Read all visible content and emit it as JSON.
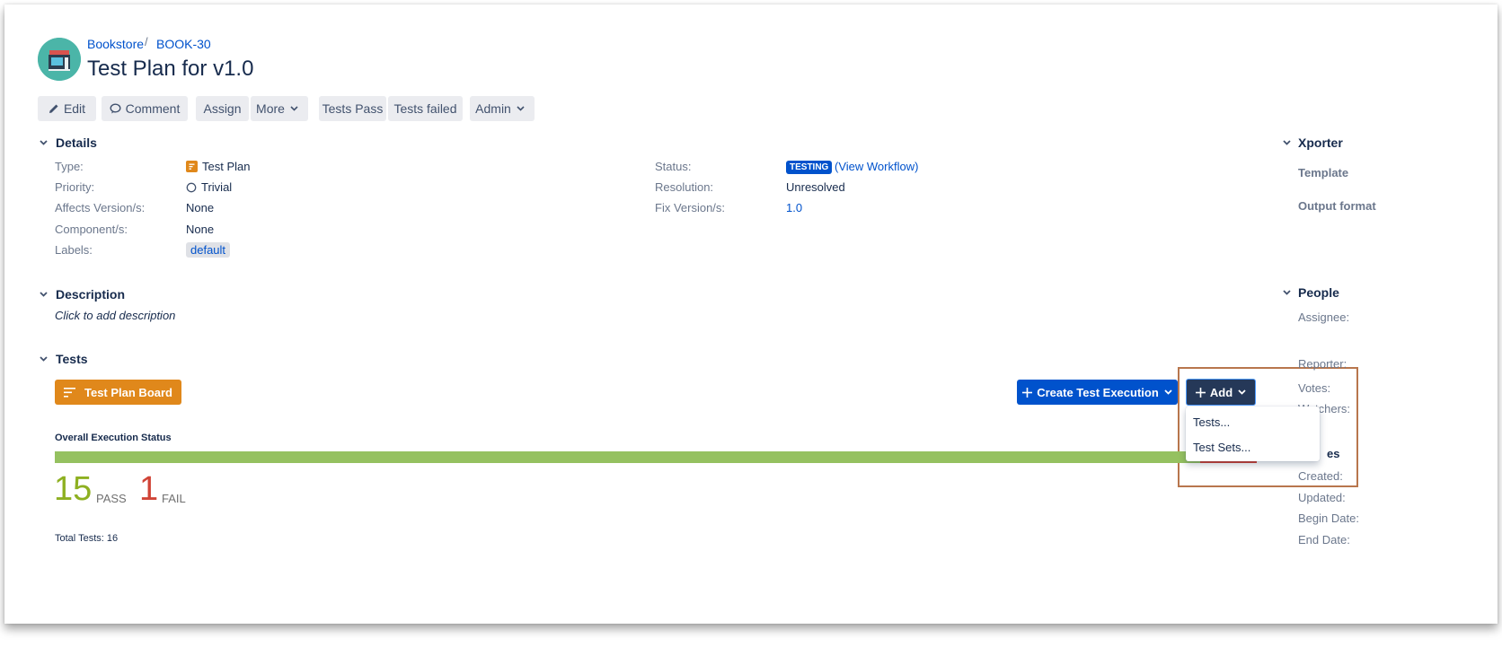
{
  "breadcrumb": {
    "project": "Bookstore",
    "separator": "/",
    "issue_key": "BOOK-30"
  },
  "issue": {
    "title": "Test Plan for v1.0"
  },
  "toolbar": {
    "edit": "Edit",
    "comment": "Comment",
    "assign": "Assign",
    "more": "More",
    "tests_pass": "Tests Pass",
    "tests_failed": "Tests failed",
    "admin": "Admin"
  },
  "details": {
    "heading": "Details",
    "type_label": "Type:",
    "type_value": "Test Plan",
    "priority_label": "Priority:",
    "priority_value": "Trivial",
    "affects_label": "Affects Version/s:",
    "affects_value": "None",
    "component_label": "Component/s:",
    "component_value": "None",
    "labels_label": "Labels:",
    "labels_value": "default",
    "status_label": "Status:",
    "status_value": "TESTING",
    "view_workflow": "(View Workflow)",
    "resolution_label": "Resolution:",
    "resolution_value": "Unresolved",
    "fix_label": "Fix Version/s:",
    "fix_value": "1.0"
  },
  "description": {
    "heading": "Description",
    "placeholder": "Click to add description"
  },
  "tests": {
    "heading": "Tests",
    "board_button": "Test Plan Board",
    "create_execution_button": "Create Test Execution",
    "add_button": "Add",
    "add_menu": [
      "Tests...",
      "Test Sets..."
    ],
    "overall_title": "Overall Execution Status",
    "pass_count": "15",
    "pass_label": "PASS",
    "fail_count": "1",
    "fail_label": "FAIL",
    "pass_fraction": 0.9375,
    "total": "Total Tests: 16"
  },
  "sidebar": {
    "xporter_heading": "Xporter",
    "template_label": "Template",
    "output_format_label": "Output format",
    "people_heading": "People",
    "assignee_label": "Assignee:",
    "reporter_label": "Reporter:",
    "votes_label": "Votes:",
    "watchers_label": "Watchers:",
    "dates_heading_partial": "es",
    "created_label": "Created:",
    "updated_label": "Updated:",
    "begin_date_label": "Begin Date:",
    "end_date_label": "End Date:"
  },
  "colors": {
    "link": "#0052cc",
    "pass": "#8eb021",
    "fail": "#d04437",
    "board_button": "#e0881b",
    "add_button": "#253858",
    "highlight": "#b8764d"
  }
}
